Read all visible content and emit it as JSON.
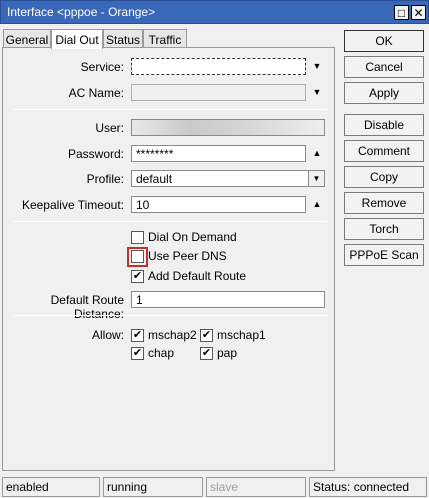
{
  "window": {
    "title": "Interface <pppoe - Orange>",
    "max_glyph": "□",
    "close_glyph": "✕"
  },
  "tabs": [
    {
      "label": "General"
    },
    {
      "label": "Dial Out"
    },
    {
      "label": "Status"
    },
    {
      "label": "Traffic"
    }
  ],
  "form": {
    "service_label": "Service:",
    "service_value": "",
    "ac_name_label": "AC Name:",
    "ac_name_value": "",
    "user_label": "User:",
    "user_value": "",
    "password_label": "Password:",
    "password_value": "********",
    "profile_label": "Profile:",
    "profile_value": "default",
    "keepalive_label": "Keepalive Timeout:",
    "keepalive_value": "10",
    "dial_on_demand_label": "Dial On Demand",
    "dial_on_demand_checked": false,
    "use_peer_dns_label": "Use Peer DNS",
    "use_peer_dns_checked": false,
    "add_default_route_label": "Add Default Route",
    "add_default_route_checked": true,
    "default_route_distance_label": "Default Route Distance:",
    "default_route_distance_value": "1",
    "allow_label": "Allow:",
    "allow": [
      {
        "label": "mschap2",
        "checked": true
      },
      {
        "label": "mschap1",
        "checked": true
      },
      {
        "label": "chap",
        "checked": true
      },
      {
        "label": "pap",
        "checked": true
      }
    ],
    "check_glyph": "✔",
    "down_arrow": "▼",
    "up_arrow": "▲",
    "dropdown_glyph": "▼"
  },
  "buttons": {
    "ok": "OK",
    "cancel": "Cancel",
    "apply": "Apply",
    "disable": "Disable",
    "comment": "Comment",
    "copy": "Copy",
    "remove": "Remove",
    "torch": "Torch",
    "pppoe_scan": "PPPoE Scan"
  },
  "status": {
    "enabled": "enabled",
    "running": "running",
    "slave": "slave",
    "connection": "Status: connected"
  },
  "colors": {
    "title_bar": "#3a68b8",
    "highlight": "#c0312b"
  }
}
